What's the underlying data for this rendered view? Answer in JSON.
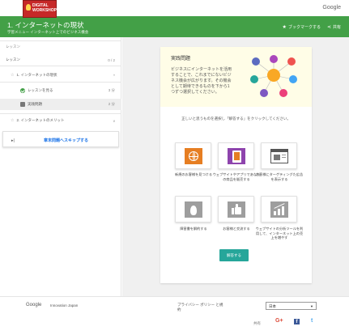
{
  "logo": {
    "lines": [
      "DIGITAL",
      "WORKSHOP"
    ]
  },
  "top": {
    "brand": "Google"
  },
  "header": {
    "title": "1. インターネットの現状",
    "breadcrumb": "学習メニュー  インターネット上でのビジネス機会",
    "bookmark_label": "ブックマークする",
    "share_label": "共有"
  },
  "sidebar": {
    "section_label": "レッスン",
    "progress": "0 / 2",
    "items": [
      {
        "label": "1. インターネットの現状",
        "indicator": "^"
      },
      {
        "label": "レッスンを見る",
        "value": "3 分"
      },
      {
        "label": "実践問題",
        "value": "2 分"
      },
      {
        "label": "2. インターネットのメリット",
        "indicator": "v"
      }
    ],
    "skip_label": "章末問題へスキップする"
  },
  "quiz": {
    "title": "実践問題",
    "intro": "ビジネスにインターネットを活用することで、これまでにないビジネス機会が広がります。その機会として期待できるものを下から1つずつ選択してください。",
    "prompt": "正しいと思うものを選択し「解答する」をクリックしてください。",
    "options": [
      {
        "label": "新規のお客様を見つける",
        "icon": "globe-icon"
      },
      {
        "label": "ウェブサイトやアプリであなたの商品を販売する",
        "icon": "tablet-icon"
      },
      {
        "label": "お客様にターゲティングた広告を表示する",
        "icon": "browser-ad-icon"
      },
      {
        "label": "障害書を解約する",
        "icon": "fire-icon"
      },
      {
        "label": "お客様と交流する",
        "icon": "thumbs-up-icon"
      },
      {
        "label": "ウェブサイトの分析ツールを利用して、インターネット上の売上を増やす",
        "icon": "analytics-chart-icon"
      }
    ],
    "submit_label": "解答する"
  },
  "footer": {
    "google": "Google",
    "innovation": "Innovation Japan",
    "privacy": "プライバシー ポリシー と規約",
    "language": "日本",
    "share_label": "共有",
    "social": [
      {
        "label": "G+",
        "color": "#dd4b39"
      },
      {
        "label": "f",
        "color": "#3b5998"
      },
      {
        "label": "t",
        "color": "#55acee"
      }
    ]
  },
  "colors": {
    "header_green": "#43a047",
    "submit_teal": "#26a69a",
    "intro_bg": "#fffde7"
  }
}
